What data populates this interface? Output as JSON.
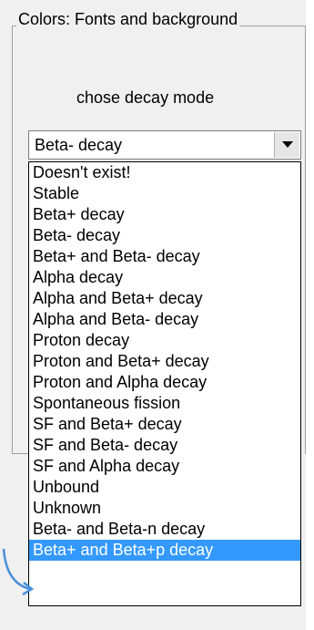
{
  "groupbox": {
    "title": "Colors: Fonts and background"
  },
  "prompt": {
    "label": "chose decay  mode"
  },
  "combo": {
    "selected_value": "Beta- decay"
  },
  "dropdown": {
    "options": [
      "Doesn't exist!",
      "Stable",
      "Beta+ decay",
      "Beta- decay",
      "Beta+ and Beta- decay",
      "Alpha decay",
      "Alpha and Beta+ decay",
      "Alpha and Beta- decay",
      "Proton decay",
      "Proton and Beta+ decay",
      "Proton and Alpha decay",
      "Spontaneous fission",
      "SF and Beta+ decay",
      "SF and Beta- decay",
      "SF and Alpha decay",
      "Unbound",
      "Unknown",
      "Beta- and Beta-n decay",
      "Beta+ and Beta+p decay"
    ],
    "highlighted": "Beta+ and Beta+p decay"
  },
  "colors": {
    "highlight": "#3399ff",
    "arrow": "#4a90d9",
    "panel": "#f0f0f0"
  }
}
